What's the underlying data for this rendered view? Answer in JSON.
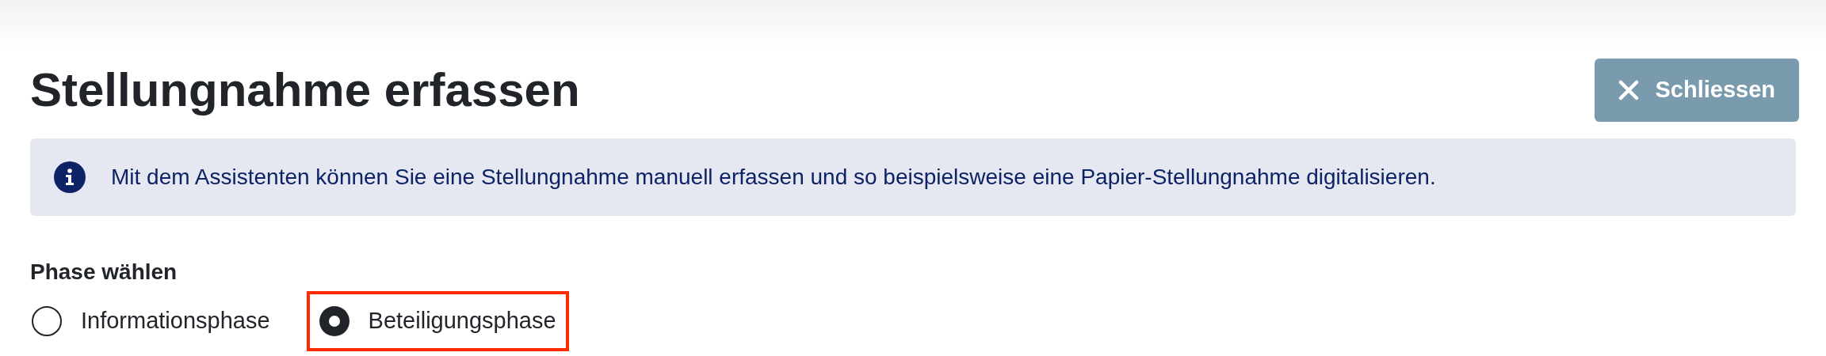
{
  "title": "Stellungnahme erfassen",
  "close_button": {
    "label": "Schliessen"
  },
  "info": {
    "text": "Mit dem Assistenten können Sie eine Stellungnahme manuell erfassen und so beispielsweise eine Papier-Stellungnahme digitalisieren."
  },
  "phase": {
    "label": "Phase wählen",
    "options": [
      {
        "label": "Informationsphase",
        "selected": false,
        "highlighted": false
      },
      {
        "label": "Beteiligungsphase",
        "selected": true,
        "highlighted": true
      }
    ]
  }
}
